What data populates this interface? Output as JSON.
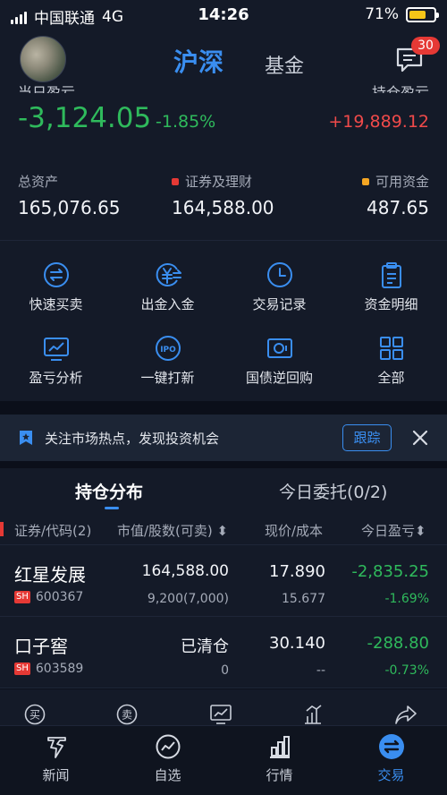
{
  "status_bar": {
    "carrier": "中国联通",
    "network": "4G",
    "time": "14:26",
    "battery": "71%",
    "battery_level": 0.71
  },
  "header": {
    "tab_active": "沪深",
    "tab_other": "基金",
    "badge": "30"
  },
  "summary": {
    "cut_label_left": "当日盈亏",
    "cut_label_right": "持仓盈亏",
    "day_pl": "-3,124.05",
    "day_pct": "-1.85%",
    "hold_pl": "+19,889.12",
    "total_assets_label": "总资产",
    "total_assets": "165,076.65",
    "securities_label": "证券及理财",
    "securities": "164,588.00",
    "available_label": "可用资金",
    "available": "487.65",
    "colors": {
      "securities_dot": "#e53935",
      "available_dot": "#f5a623",
      "up": "#f04a4a",
      "down": "#2fba5c"
    }
  },
  "actions": [
    {
      "label": "快速买卖",
      "icon": "swap-icon"
    },
    {
      "label": "出金入金",
      "icon": "yuan-transfer-icon"
    },
    {
      "label": "交易记录",
      "icon": "clock-icon"
    },
    {
      "label": "资金明细",
      "icon": "clipboard-icon"
    },
    {
      "label": "盈亏分析",
      "icon": "chart-icon"
    },
    {
      "label": "一键打新",
      "icon": "ipo-icon"
    },
    {
      "label": "国债逆回购",
      "icon": "bond-icon"
    },
    {
      "label": "全部",
      "icon": "grid-icon"
    }
  ],
  "banner": {
    "text": "关注市场热点，发现投资机会",
    "button": "跟踪"
  },
  "positions": {
    "tab_active": "持仓分布",
    "tab_other": "今日委托(0/2)",
    "columns": [
      "证券/代码(2)",
      "市值/股数(可卖)",
      "现价/成本",
      "今日盈亏"
    ],
    "rows": [
      {
        "name": "红星发展",
        "market": "SH",
        "code": "600367",
        "value": "164,588.00",
        "qty": "9,200(7,000)",
        "price": "17.890",
        "cost": "15.677",
        "pl": "-2,835.25",
        "pl_pct": "-1.69%"
      },
      {
        "name": "口子窖",
        "market": "SH",
        "code": "603589",
        "value": "已清仓",
        "qty": "0",
        "price": "30.140",
        "cost": "--",
        "pl": "-288.80",
        "pl_pct": "-0.73%"
      }
    ],
    "ops": [
      {
        "icon": "buy-icon",
        "glyph": "买"
      },
      {
        "icon": "sell-icon",
        "glyph": "卖"
      },
      {
        "icon": "trend-icon"
      },
      {
        "icon": "analysis-icon"
      },
      {
        "icon": "share-icon"
      }
    ]
  },
  "bottom_nav": [
    {
      "label": "新闻",
      "icon": "news-icon"
    },
    {
      "label": "自选",
      "icon": "watchlist-icon"
    },
    {
      "label": "行情",
      "icon": "market-icon"
    },
    {
      "label": "交易",
      "icon": "trade-icon"
    }
  ]
}
